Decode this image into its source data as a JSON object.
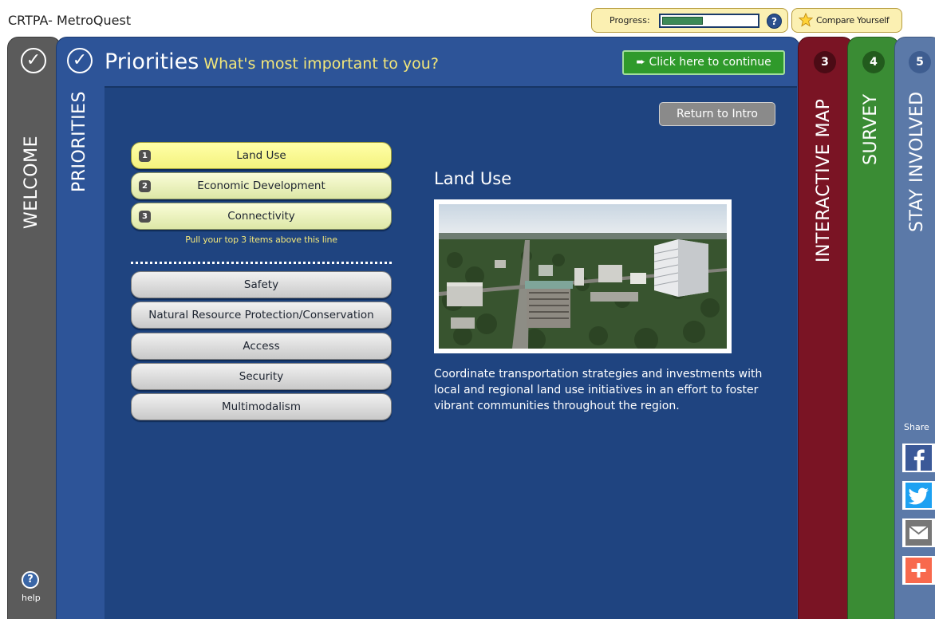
{
  "app": {
    "title": "CRTPA- MetroQuest"
  },
  "header": {
    "progress_label": "Progress:",
    "progress_fraction": 0.42,
    "help_glyph": "?",
    "compare_label": "Compare Yourself"
  },
  "tabs": {
    "welcome": {
      "label": "WELCOME",
      "status": "✓"
    },
    "priorities": {
      "label": "PRIORITIES",
      "status": "✓"
    },
    "interactive_map": {
      "label": "INTERACTIVE MAP",
      "number": "3"
    },
    "survey": {
      "label": "SURVEY",
      "number": "4"
    },
    "stay_involved": {
      "label": "STAY INVOLVED",
      "number": "5"
    }
  },
  "main": {
    "title": "Priorities",
    "subtitle": "What's most important to you?",
    "continue_label": "Click here to continue",
    "return_label": "Return to Intro",
    "top_priorities": [
      {
        "rank": "1",
        "label": "Land Use"
      },
      {
        "rank": "2",
        "label": "Economic Development"
      },
      {
        "rank": "3",
        "label": "Connectivity"
      }
    ],
    "pull_note": "Pull your top 3 items above this line",
    "other_priorities": [
      {
        "label": "Safety"
      },
      {
        "label": "Natural Resource Protection/Conservation"
      },
      {
        "label": "Access"
      },
      {
        "label": "Security"
      },
      {
        "label": "Multimodalism"
      }
    ],
    "detail": {
      "title": "Land Use",
      "description": "Coordinate transportation strategies and investments with local and regional land use initiatives in an effort to foster vibrant communities throughout the region."
    }
  },
  "share": {
    "label": "Share"
  },
  "help": {
    "glyph": "?",
    "label": "help"
  },
  "colors": {
    "priorities_panel": "#2d5498",
    "content_bg": "#1f4480",
    "map_panel": "#7a1424",
    "survey_panel": "#3a8c34",
    "stay_panel": "#5b79a8",
    "welcome_panel": "#5b5b5b",
    "continue_green": "#2f9a2b",
    "accent_yellow": "#f3e77a",
    "facebook": "#3b5998",
    "twitter": "#1da1f2",
    "email": "#777777",
    "addthis": "#f8694d"
  }
}
